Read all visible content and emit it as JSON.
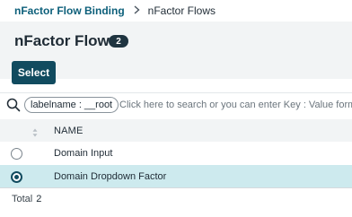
{
  "breadcrumb": {
    "parent": "nFactor Flow Binding",
    "separator_icon": "chevron-right-icon",
    "current": "nFactor Flows"
  },
  "header": {
    "title": "nFactor Flows",
    "count": "2"
  },
  "toolbar": {
    "select_label": "Select"
  },
  "search": {
    "icon": "search-icon",
    "chip": "labelname : __root",
    "placeholder": "Click here to search or you can enter Key : Value format"
  },
  "table": {
    "columns": [
      "NAME"
    ],
    "rows": [
      {
        "name": "Domain Input",
        "selected": false
      },
      {
        "name": "Domain Dropdown Factor",
        "selected": true
      }
    ]
  },
  "footer": {
    "total_label": "Total",
    "total_value": "2"
  },
  "colors": {
    "accent": "#114b5f",
    "selected_row": "#cdeaee",
    "header_bg": "#f2f4f5",
    "link": "#0c5f7a"
  }
}
